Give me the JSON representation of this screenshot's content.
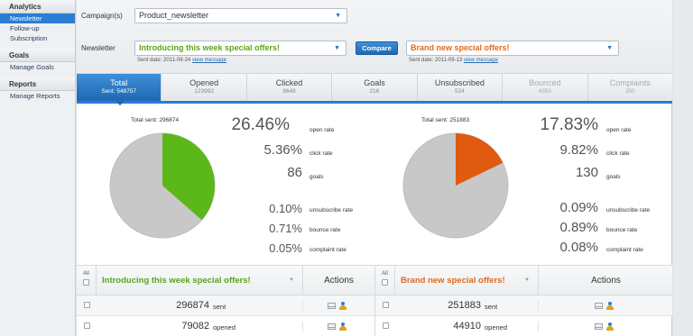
{
  "sidebar": {
    "sections": [
      {
        "title": "Analytics",
        "items": [
          "Newsletter",
          "Follow-up",
          "Subscription"
        ]
      },
      {
        "title": "Goals",
        "items": [
          "Manage Goals"
        ]
      },
      {
        "title": "Reports",
        "items": [
          "Manage Reports"
        ]
      }
    ],
    "active_item": "Newsletter"
  },
  "campaign": {
    "label": "Campaign(s)",
    "value": "Product_newsletter"
  },
  "newsletter": {
    "label": "Newsletter",
    "left": {
      "value": "Introducing this week special offers!",
      "sent_date": "Sent date: 2011-08-24",
      "view_link": "view message"
    },
    "compare_label": "Compare",
    "right": {
      "value": "Brand new special offers!",
      "sent_date": "Sent date: 2011-09-13",
      "view_link": "view message"
    }
  },
  "tabs": [
    {
      "title": "Total",
      "count": "Sent: 548757"
    },
    {
      "title": "Opened",
      "count": "123992"
    },
    {
      "title": "Clicked",
      "count": "8648"
    },
    {
      "title": "Goals",
      "count": "216"
    },
    {
      "title": "Unsubscribed",
      "count": "524"
    },
    {
      "title": "Bounced",
      "count": "4350"
    },
    {
      "title": "Complaints",
      "count": "350"
    }
  ],
  "left_stats": {
    "total_sent": "Total sent: 296874",
    "open_rate": "26.46%",
    "open_rate_label": "open rate",
    "click_rate": "5.36%",
    "click_rate_label": "click rate",
    "goals": "86",
    "goals_label": "goals",
    "unsubscribe_rate": "0.10%",
    "unsubscribe_rate_label": "unsubscribe rate",
    "bounce_rate": "0.71%",
    "bounce_rate_label": "bounce rate",
    "complaint_rate": "0.05%",
    "complaint_rate_label": "complaint rate",
    "pie_fraction": 0.3646,
    "pie_color": "#5cb81a"
  },
  "right_stats": {
    "total_sent": "Total sent: 251883",
    "open_rate": "17.83%",
    "open_rate_label": "open rate",
    "click_rate": "9.82%",
    "click_rate_label": "click rate",
    "goals": "130",
    "goals_label": "goals",
    "unsubscribe_rate": "0.09%",
    "unsubscribe_rate_label": "unsubscribe rate",
    "bounce_rate": "0.89%",
    "bounce_rate_label": "bounce rate",
    "complaint_rate": "0.08%",
    "complaint_rate_label": "complaint rate",
    "pie_fraction": 0.1783,
    "pie_color": "#e05a10"
  },
  "left_table": {
    "all_label": "All",
    "title": "Introducing this week special offers!",
    "actions_label": "Actions",
    "rows": [
      {
        "num": "296874",
        "unit": "sent"
      },
      {
        "num": "79082",
        "unit": "opened"
      }
    ]
  },
  "right_table": {
    "all_label": "All",
    "title": "Brand new special offers!",
    "actions_label": "Actions",
    "rows": [
      {
        "num": "251883",
        "unit": "sent"
      },
      {
        "num": "44910",
        "unit": "opened"
      }
    ]
  },
  "colors": {
    "accent": "#2a7dd0",
    "green": "#5aa51b",
    "orange": "#e06a1b"
  }
}
